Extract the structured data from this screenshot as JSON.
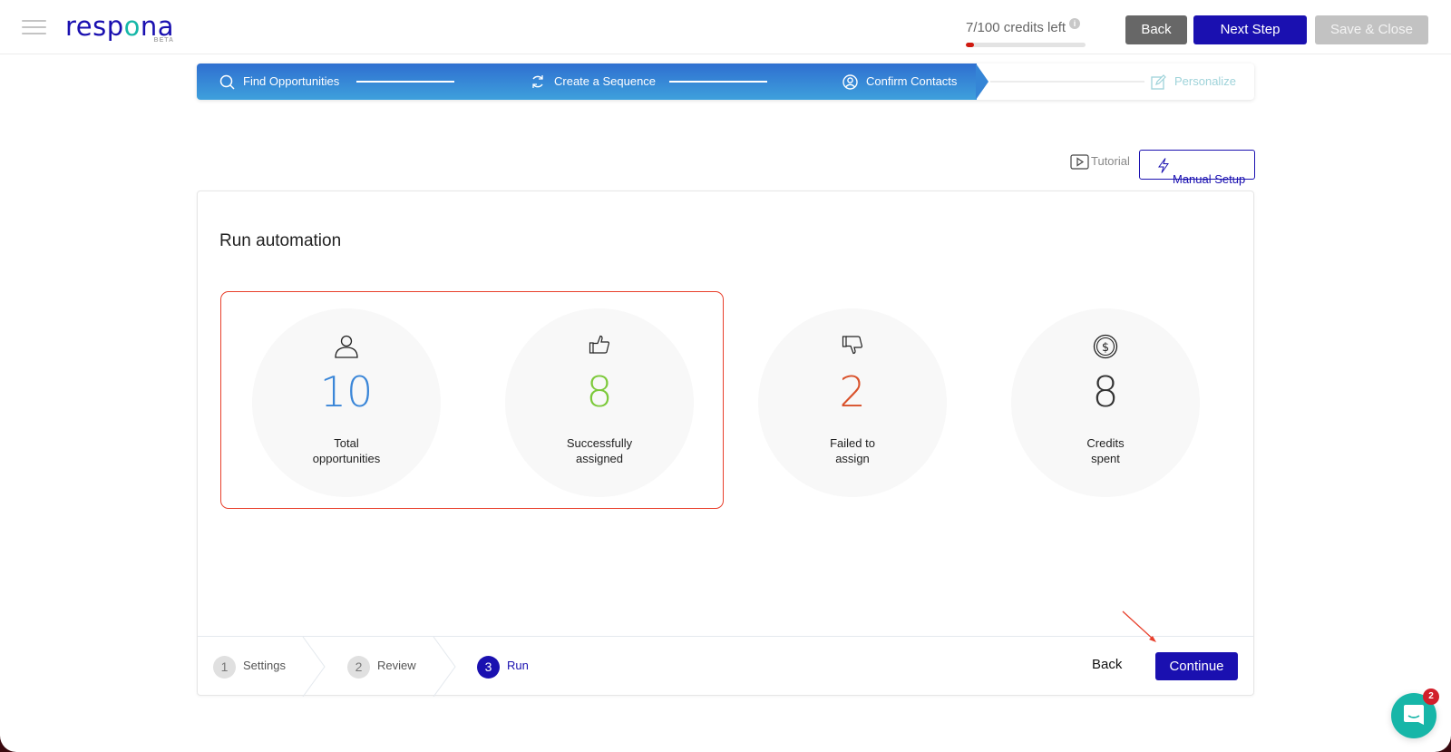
{
  "header": {
    "logo": {
      "text_before": "resp",
      "text_o": "o",
      "text_after": "na",
      "badge": "BETA"
    },
    "credits": {
      "label": "7/100 credits left",
      "used": 7,
      "total": 100,
      "info_icon": "i"
    },
    "buttons": {
      "back": "Back",
      "next_step": "Next Step",
      "save_close": "Save & Close"
    }
  },
  "stepper": {
    "steps": [
      {
        "label": "Find Opportunities",
        "icon": "search-icon",
        "state": "complete"
      },
      {
        "label": "Create a Sequence",
        "icon": "refresh-icon",
        "state": "complete"
      },
      {
        "label": "Confirm Contacts",
        "icon": "user-circle-icon",
        "state": "current"
      },
      {
        "label": "Personalize",
        "icon": "edit-icon",
        "state": "upcoming"
      }
    ]
  },
  "toolbar": {
    "tutorial": "Tutorial",
    "manual_setup": "Manual Setup"
  },
  "card": {
    "title": "Run automation",
    "stats": [
      {
        "icon": "user-icon",
        "value": "10",
        "caption_line1": "Total",
        "caption_line2": "opportunities",
        "color": "#3a86d8"
      },
      {
        "icon": "thumbs-up-icon",
        "value": "8",
        "caption_line1": "Successfully",
        "caption_line2": "assigned",
        "color": "#7cc93a"
      },
      {
        "icon": "thumbs-down-icon",
        "value": "2",
        "caption_line1": "Failed to",
        "caption_line2": "assign",
        "color": "#d9512a"
      },
      {
        "icon": "coin-icon",
        "value": "8",
        "caption_line1": "Credits",
        "caption_line2": "spent",
        "color": "#333333"
      }
    ],
    "wizard": [
      {
        "number": "1",
        "label": "Settings",
        "state": "done"
      },
      {
        "number": "2",
        "label": "Review",
        "state": "done"
      },
      {
        "number": "3",
        "label": "Run",
        "state": "active"
      }
    ],
    "footer_buttons": {
      "back": "Back",
      "continue": "Continue"
    }
  },
  "chat": {
    "badge_count": "2"
  },
  "colors": {
    "brand": "#1a10b0",
    "accent_teal": "#17b6a8",
    "highlight_red": "#e8402c"
  }
}
